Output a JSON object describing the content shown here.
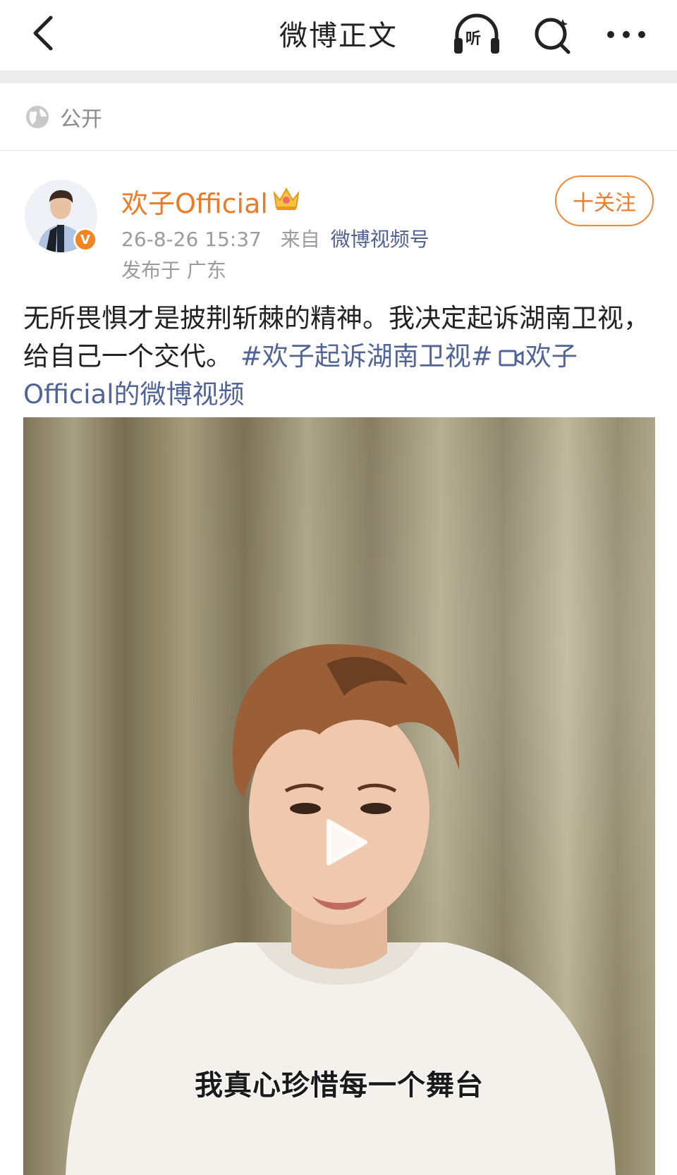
{
  "nav": {
    "title": "微博正文",
    "listen_label": "听"
  },
  "visibility": {
    "label": "公开"
  },
  "post": {
    "username": "欢子Official",
    "follow_label": "十关注",
    "time": "26-8-26 15:37",
    "from_label": "来自",
    "source": "微博视频号",
    "location": "发布于 广东",
    "text": "无所畏惧才是披荆斩棘的精神。我决定起诉湖南卫视，给自己一个交代。",
    "hashtag": "#欢子起诉湖南卫视#",
    "video_link": "欢子Official的微博视频",
    "video_subtitle": "我真心珍惜每一个舞台"
  },
  "colors": {
    "accent": "#eb7b26",
    "link": "#506497"
  },
  "icons": [
    "back-icon",
    "listen-icon",
    "search-icon",
    "more-icon",
    "globe-icon",
    "crown-icon",
    "verified-icon",
    "video-camera-icon",
    "play-icon"
  ]
}
